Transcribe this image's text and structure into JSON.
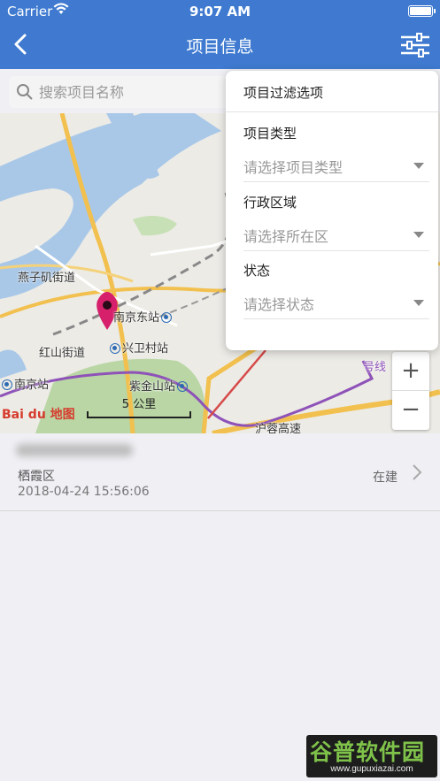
{
  "status_bar": {
    "carrier": "Carrier",
    "time": "9:07 AM"
  },
  "nav": {
    "title": "项目信息",
    "back_icon": "chevron-left-icon",
    "filter_icon": "sliders-icon"
  },
  "search": {
    "placeholder": "搜索项目名称"
  },
  "map": {
    "labels": {
      "yanziji": "燕子矶街道",
      "nanjing_east": "南京东站",
      "xingwei": "兴卫村站",
      "hongshan": "红山街道",
      "nanjing_station": "南京站",
      "zijinshan": "紫金山站",
      "hurong": "沪蓉高速",
      "line": "号线"
    },
    "scale": "5 公里",
    "logo_text": "Bai du 地图",
    "zoom_in": "+",
    "zoom_out": "−"
  },
  "filter_panel": {
    "title": "项目过滤选项",
    "type_label": "项目类型",
    "type_placeholder": "请选择项目类型",
    "district_label": "行政区域",
    "district_placeholder": "请选择所在区",
    "status_label": "状态",
    "status_placeholder": "请选择状态"
  },
  "projects": [
    {
      "district": "栖霞区",
      "datetime": "2018-04-24 15:56:06",
      "status": "在建"
    }
  ],
  "watermark": {
    "title": "谷普软件园",
    "url": "www.gupuxiazai.com"
  },
  "colors": {
    "header": "#3f7ad0",
    "water": "#a9c8e8",
    "road": "#f2c04e"
  }
}
